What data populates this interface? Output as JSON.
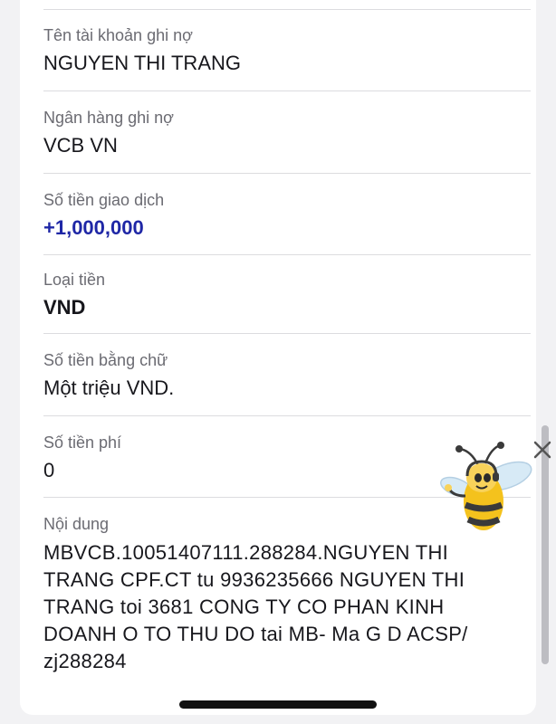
{
  "fields": [
    {
      "label": "Tên tài khoản ghi nợ",
      "value": "NGUYEN THI TRANG"
    },
    {
      "label": "Ngân hàng ghi nợ",
      "value": "VCB VN"
    },
    {
      "label": "Số tiền giao dịch",
      "value": "+1,000,000"
    },
    {
      "label": "Loại tiền",
      "value": "VND"
    },
    {
      "label": "Số tiền bằng chữ",
      "value": "Một triệu VND."
    },
    {
      "label": "Số tiền phí",
      "value": "0"
    },
    {
      "label": "Nội dung",
      "value": "MBVCB.10051407111.288284.NGUYEN THI TRANG CPF.CT tu 9936235666 NGUYEN THI TRANG toi 3681 CONG TY CO PHAN KINH DOANH O TO THU DO tai MB- Ma G D ACSP/ zj288284"
    }
  ],
  "colors": {
    "amount": "#1f27a6",
    "label": "#6b6b72",
    "value": "#17171c"
  },
  "icons": {
    "close": "close-icon",
    "mascot": "bee-mascot-icon"
  }
}
